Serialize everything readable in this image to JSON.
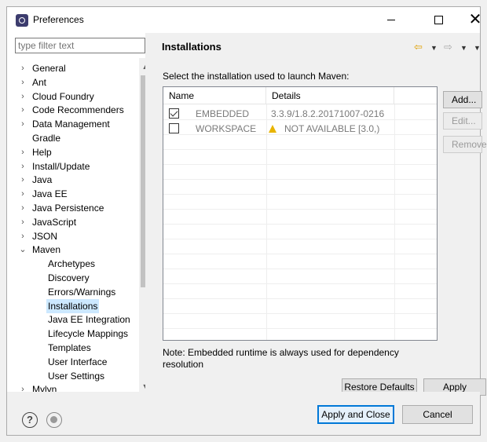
{
  "window": {
    "title": "Preferences",
    "min_glyph": "",
    "max_glyph": "",
    "close_glyph": "✕"
  },
  "sidebar": {
    "filter_placeholder": "type filter text",
    "items": [
      {
        "label": "General",
        "expandable": true,
        "level": 0
      },
      {
        "label": "Ant",
        "expandable": true,
        "level": 0
      },
      {
        "label": "Cloud Foundry",
        "expandable": true,
        "level": 0
      },
      {
        "label": "Code Recommenders",
        "expandable": true,
        "level": 0
      },
      {
        "label": "Data Management",
        "expandable": true,
        "level": 0
      },
      {
        "label": "Gradle",
        "expandable": false,
        "level": 0
      },
      {
        "label": "Help",
        "expandable": true,
        "level": 0
      },
      {
        "label": "Install/Update",
        "expandable": true,
        "level": 0
      },
      {
        "label": "Java",
        "expandable": true,
        "level": 0
      },
      {
        "label": "Java EE",
        "expandable": true,
        "level": 0
      },
      {
        "label": "Java Persistence",
        "expandable": true,
        "level": 0
      },
      {
        "label": "JavaScript",
        "expandable": true,
        "level": 0
      },
      {
        "label": "JSON",
        "expandable": true,
        "level": 0
      },
      {
        "label": "Maven",
        "expandable": true,
        "expanded": true,
        "level": 0
      },
      {
        "label": "Archetypes",
        "level": 1
      },
      {
        "label": "Discovery",
        "level": 1
      },
      {
        "label": "Errors/Warnings",
        "level": 1
      },
      {
        "label": "Installations",
        "level": 1,
        "selected": true
      },
      {
        "label": "Java EE Integration",
        "level": 1
      },
      {
        "label": "Lifecycle Mappings",
        "level": 1
      },
      {
        "label": "Templates",
        "level": 1
      },
      {
        "label": "User Interface",
        "level": 1
      },
      {
        "label": "User Settings",
        "level": 1
      },
      {
        "label": "Mylyn",
        "expandable": true,
        "level": 0
      }
    ]
  },
  "page": {
    "title": "Installations",
    "prompt": "Select the installation used to launch Maven:",
    "table": {
      "columns": [
        "Name",
        "Details"
      ],
      "rows": [
        {
          "checked": true,
          "name": "EMBEDDED",
          "details": "3.3.9/1.8.2.20171007-0216",
          "warning": false
        },
        {
          "checked": false,
          "name": "WORKSPACE",
          "details": "NOT AVAILABLE [3.0,)",
          "warning": true
        }
      ]
    },
    "buttons": {
      "add": "Add...",
      "edit": "Edit...",
      "remove": "Remove"
    },
    "note": "Note: Embedded runtime is always used for dependency resolution",
    "restore_defaults": "Restore Defaults",
    "apply": "Apply"
  },
  "footer": {
    "apply_and_close": "Apply and Close",
    "cancel": "Cancel"
  },
  "colors": {
    "selection": "#cce8ff",
    "default_button_border": "#0078d7",
    "warning": "#e8b400"
  }
}
